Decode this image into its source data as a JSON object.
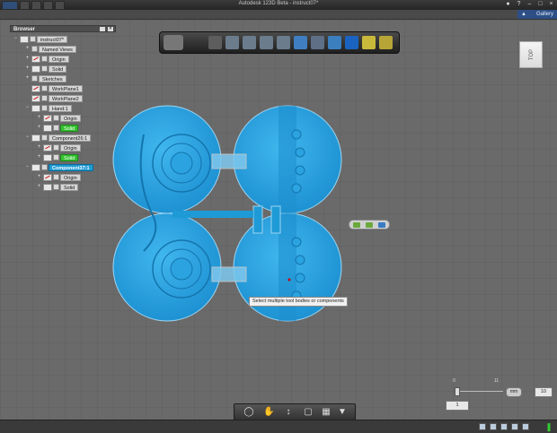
{
  "app": {
    "title": "Autodesk 123D Beta - instruct07*",
    "gallery_label": "Gallery"
  },
  "browser": {
    "header": "Browser",
    "items": [
      {
        "label": "instruct07*",
        "level": 0,
        "toggle": "−",
        "eye": true
      },
      {
        "label": "Named Views",
        "level": 1,
        "toggle": "+",
        "eye": false
      },
      {
        "label": "Origin",
        "level": 1,
        "toggle": "+",
        "eye": "off"
      },
      {
        "label": "Solid",
        "level": 1,
        "toggle": "+",
        "eye": true
      },
      {
        "label": "Sketches",
        "level": 1,
        "toggle": "+",
        "eye": false
      },
      {
        "label": "WorkPlane1",
        "level": 1,
        "toggle": "",
        "eye": "off"
      },
      {
        "label": "WorkPlane2",
        "level": 1,
        "toggle": "",
        "eye": "off"
      },
      {
        "label": "Hand:1",
        "level": 1,
        "toggle": "−",
        "eye": true
      },
      {
        "label": "Origin",
        "level": 2,
        "toggle": "+",
        "eye": "off"
      },
      {
        "label": "Solid",
        "level": 2,
        "toggle": "+",
        "eye": true,
        "style": "green"
      },
      {
        "label": "Component26:1",
        "level": 1,
        "toggle": "−",
        "eye": true
      },
      {
        "label": "Origin",
        "level": 2,
        "toggle": "+",
        "eye": "off"
      },
      {
        "label": "Solid",
        "level": 2,
        "toggle": "+",
        "eye": true,
        "style": "green"
      },
      {
        "label": "Component37:1",
        "level": 1,
        "toggle": "−",
        "eye": true,
        "style": "sel"
      },
      {
        "label": "Origin",
        "level": 2,
        "toggle": "+",
        "eye": "off"
      },
      {
        "label": "Solid",
        "level": 2,
        "toggle": "+",
        "eye": true
      }
    ]
  },
  "viewcube": {
    "face": "TOP"
  },
  "tooltip": {
    "text": "Select multiple tool bodies or components"
  },
  "grid": {
    "unit": "mm",
    "value": "10",
    "snap_value": "1",
    "tick_min": "0",
    "tick_max": "11"
  },
  "colors": {
    "model": "#1e9ad6",
    "model_dark": "#1480b8",
    "selection": "#1f9bd4",
    "solid_green": "#34c22f"
  }
}
